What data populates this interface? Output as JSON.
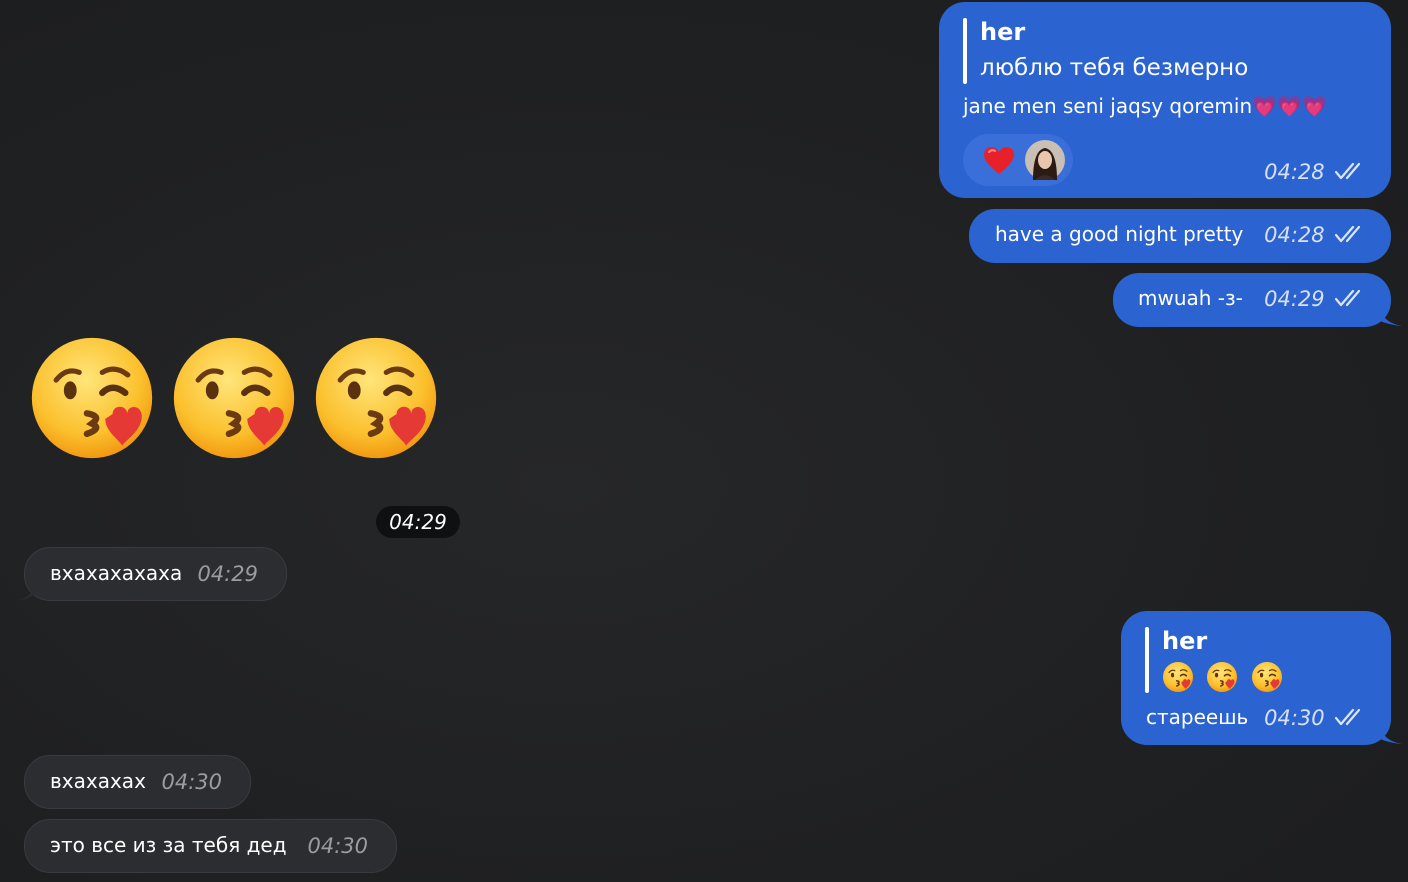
{
  "messages": {
    "m1": {
      "quote_name": "her",
      "quote_text": "люблю тебя безмерно",
      "text": "jane men seni jaqsy qoremin💗💗💗",
      "time": "04:28",
      "reaction": "heart-icon"
    },
    "m2": {
      "text": "have a good night pretty",
      "time": "04:28"
    },
    "m3": {
      "text": "mwuah -з-",
      "time": "04:29"
    },
    "m4": {
      "emoji": [
        "kissing-face-icon",
        "kissing-face-icon",
        "kissing-face-icon"
      ],
      "time": "04:29"
    },
    "m5": {
      "text": "вхахахахаха",
      "time": "04:29"
    },
    "m6": {
      "quote_name": "her",
      "quote_emoji": [
        "kissing-face-icon",
        "kissing-face-icon",
        "kissing-face-icon"
      ],
      "text": "стареешь",
      "time": "04:30"
    },
    "m7": {
      "text": "вхахахах",
      "time": "04:30"
    },
    "m8": {
      "text": "это все из за тебя дед",
      "time": "04:30"
    }
  },
  "colors": {
    "outgoing_bubble": "#2b63d0",
    "incoming_bubble": "#2c2d30",
    "background": "#202123"
  }
}
